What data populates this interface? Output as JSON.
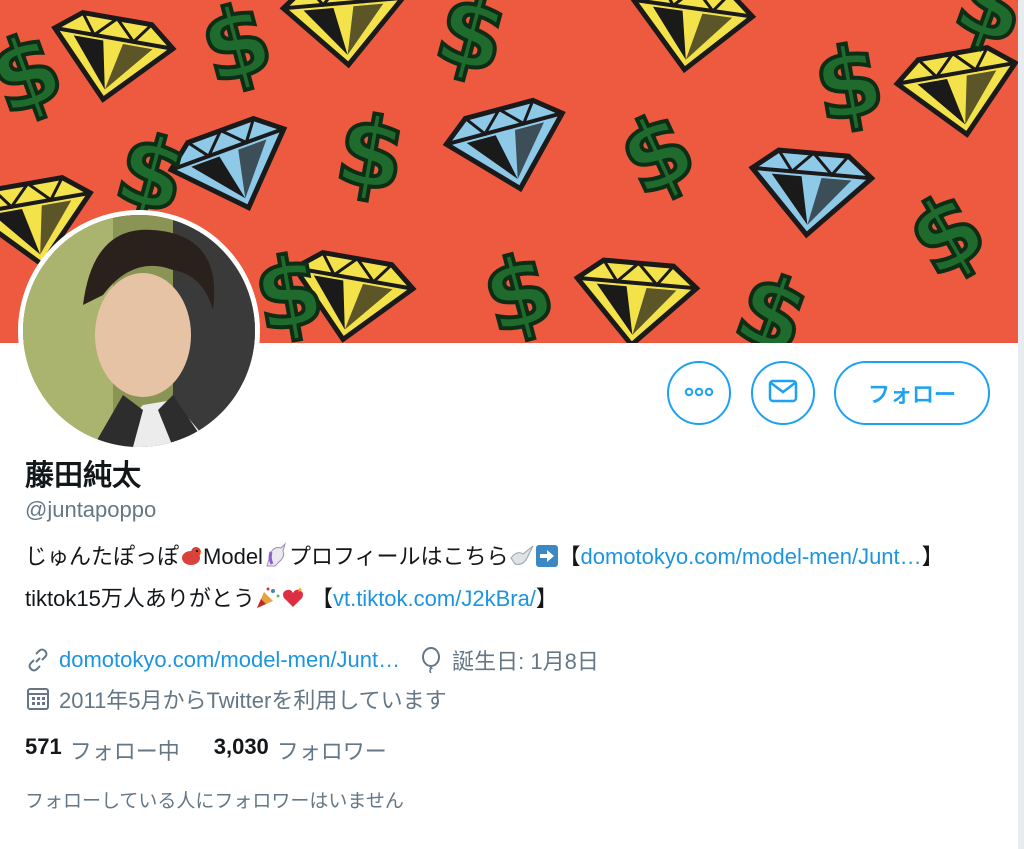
{
  "profile": {
    "name": "藤田純太",
    "handle": "@juntapoppo",
    "bio": {
      "text1": "じゅんたぽっぽ",
      "text2": "Model",
      "text3": "プロフィールはこちら",
      "bracket_open": "【",
      "link1": "domotokyo.com/model-men/Junt…",
      "text4": "】tiktok15万人ありがとう",
      "link2": "vt.tiktok.com/J2kBra/",
      "bracket_close": "】"
    },
    "website": "domotokyo.com/model-men/Junt…",
    "birthday": "誕生日: 1月8日",
    "joined": "2011年5月からTwitterを利用しています",
    "following_count": "571",
    "following_label": "フォロー中",
    "followers_count": "3,030",
    "followers_label": "フォロワー",
    "followed_by_note": "フォローしている人にフォロワーはいません"
  },
  "actions": {
    "follow_label": "フォロー"
  },
  "icons": {
    "more": "more-icon",
    "dm": "envelope-icon",
    "link": "link-icon",
    "birthday": "balloon-icon",
    "calendar": "calendar-icon"
  },
  "colors": {
    "accent": "#1da1f2",
    "link": "#1b95e0",
    "secondary_text": "#657786",
    "banner": "#ee5a3f"
  }
}
